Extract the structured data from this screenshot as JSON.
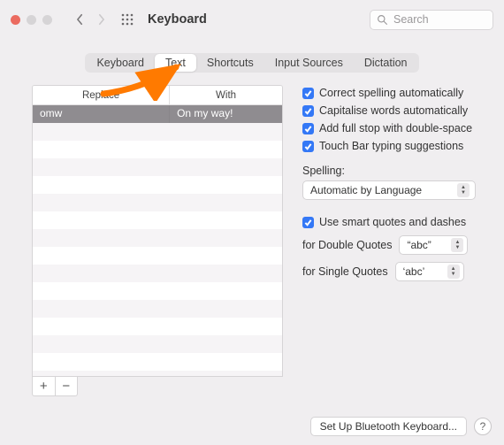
{
  "window": {
    "title": "Keyboard"
  },
  "search": {
    "placeholder": "Search"
  },
  "tabs": [
    "Keyboard",
    "Text",
    "Shortcuts",
    "Input Sources",
    "Dictation"
  ],
  "activeTab": "Text",
  "table": {
    "headers": {
      "replace": "Replace",
      "with": "With"
    },
    "rows": [
      {
        "replace": "omw",
        "with": "On my way!",
        "selected": true
      }
    ]
  },
  "options": {
    "correct_spelling": "Correct spelling automatically",
    "capitalise_words": "Capitalise words automatically",
    "full_stop": "Add full stop with double-space",
    "touch_bar": "Touch Bar typing suggestions",
    "spelling_label": "Spelling:",
    "spelling_value": "Automatic by Language",
    "smart_quotes": "Use smart quotes and dashes",
    "double_label": "for Double Quotes",
    "double_value": "“abc”",
    "single_label": "for Single Quotes",
    "single_value": "‘abc’"
  },
  "footer": {
    "bluetooth": "Set Up Bluetooth Keyboard...",
    "help": "?"
  },
  "icons": {
    "plus": "+",
    "minus": "−",
    "caret": "⌃"
  }
}
